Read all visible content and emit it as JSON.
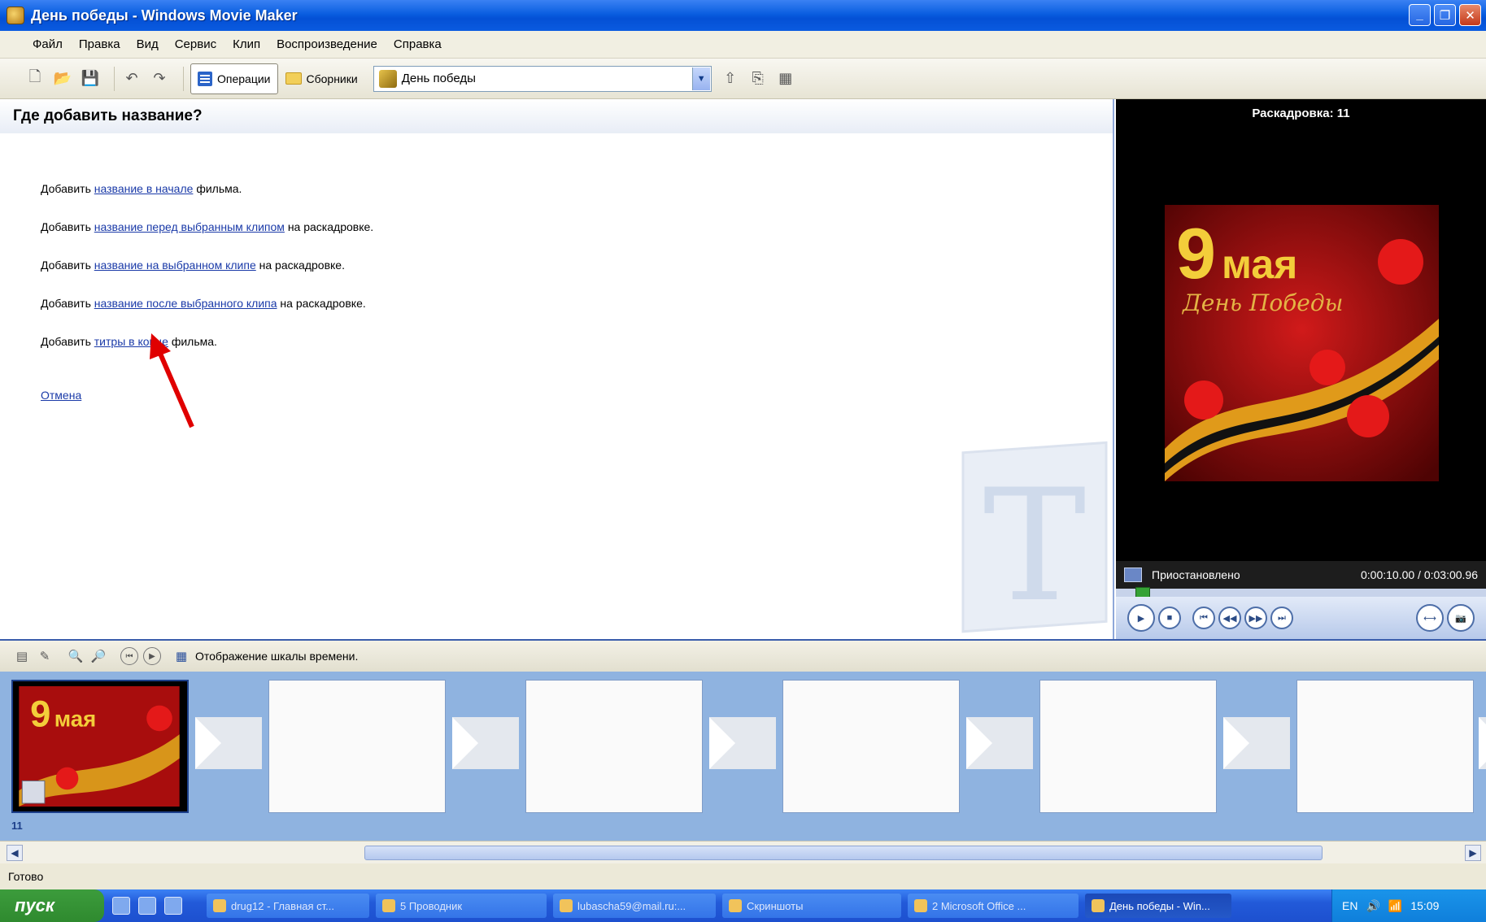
{
  "window": {
    "title": "День победы - Windows Movie Maker"
  },
  "menu": [
    "Файл",
    "Правка",
    "Вид",
    "Сервис",
    "Клип",
    "Воспроизведение",
    "Справка"
  ],
  "toolbar": {
    "operations_label": "Операции",
    "collections_label": "Сборники",
    "project_name": "День победы"
  },
  "task": {
    "heading": "Где добавить название?",
    "prefix": "Добавить",
    "options": [
      {
        "link": "название в начале",
        "suffix": "фильма."
      },
      {
        "link": "название перед выбранным клипом",
        "suffix": "на раскадровке."
      },
      {
        "link": "название на выбранном клипе",
        "suffix": "на раскадровке."
      },
      {
        "link": "название после выбранного клипа",
        "suffix": "на раскадровке."
      },
      {
        "link": "титры в конце",
        "suffix": "фильма."
      }
    ],
    "cancel": "Отмена"
  },
  "preview": {
    "title": "Раскадровка: 11",
    "status": "Приостановлено",
    "time": "0:00:10.00 / 0:03:00.96",
    "image_big": "9",
    "image_text": "мая",
    "image_sub": "День Победы"
  },
  "storyboard": {
    "toggle_label": "Отображение шкалы времени.",
    "clip_number": "11",
    "clip_big": "9",
    "clip_text": "мая"
  },
  "statusbar": {
    "text": "Готово"
  },
  "taskbar": {
    "start": "пуск",
    "tasks": [
      "drug12 - Главная ст...",
      "5 Проводник",
      "lubascha59@mail.ru:...",
      "Скриншоты",
      "2 Microsoft Office ...",
      "День победы - Win..."
    ],
    "lang": "EN",
    "clock": "15:09"
  },
  "colors": {
    "titlebar": "#0a5ee0",
    "storyboard_bg": "#8fb3e0",
    "link": "#1a3aa8",
    "start": "#2f8a2f"
  }
}
